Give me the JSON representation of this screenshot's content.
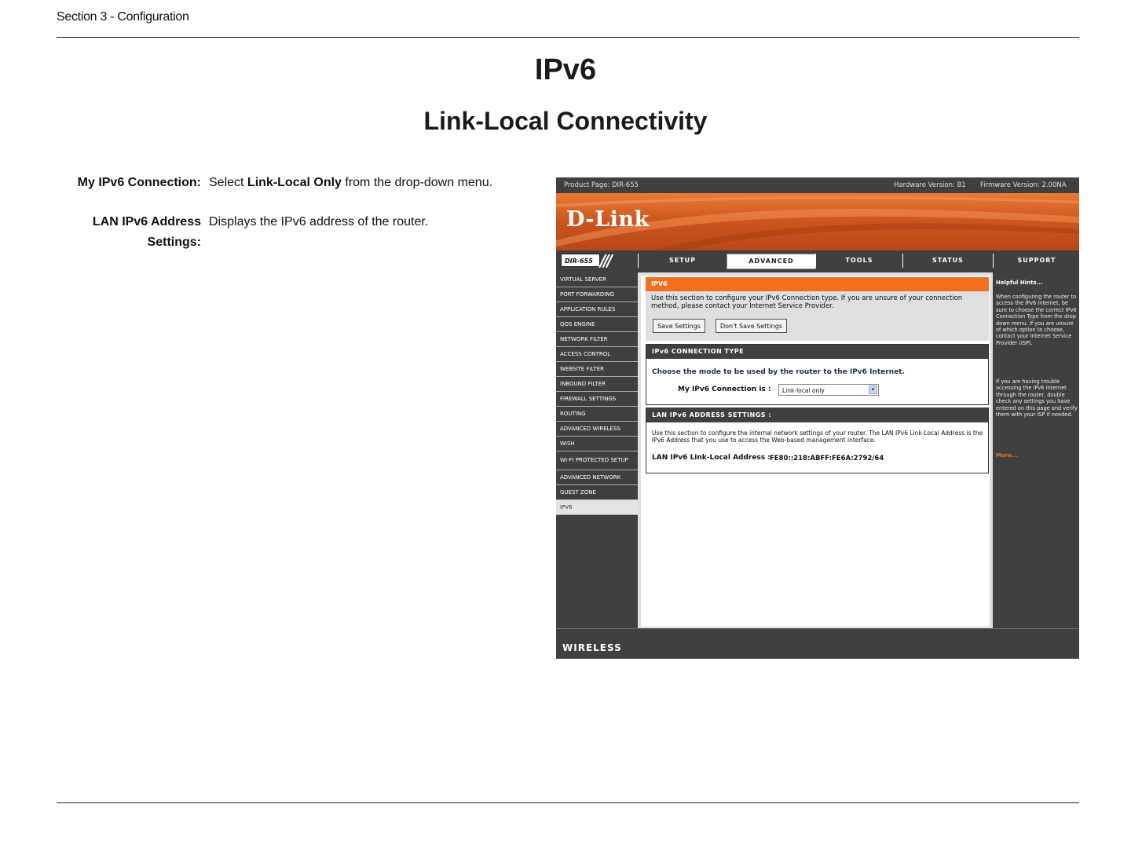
{
  "header": {
    "section": "Section 3 - Configuration"
  },
  "title": "IPv6",
  "subtitle": "Link-Local Connectivity",
  "definitions": [
    {
      "term": "My IPv6 Connection:",
      "desc_pre": "Select ",
      "desc_bold": "Link-Local Only",
      "desc_post": " from the drop-down menu."
    },
    {
      "term": "LAN IPv6 Address Settings:",
      "desc": "Displays the IPv6 address of the router."
    }
  ],
  "router": {
    "top_bar": {
      "product": "Product Page: DIR-655",
      "hardware": "Hardware Version: B1",
      "firmware": "Firmware Version: 2.00NA"
    },
    "logo": "D-Link",
    "model": "DIR-655",
    "tabs": [
      "SETUP",
      "ADVANCED",
      "TOOLS",
      "STATUS",
      "SUPPORT"
    ],
    "active_tab": "ADVANCED",
    "left_nav": [
      "VIRTUAL SERVER",
      "PORT FORWARDING",
      "APPLICATION RULES",
      "QOS ENGINE",
      "NETWORK FILTER",
      "ACCESS CONTROL",
      "WEBSITE FILTER",
      "INBOUND FILTER",
      "FIREWALL SETTINGS",
      "ROUTING",
      "ADVANCED WIRELESS",
      "WISH",
      "WI-FI PROTECTED SETUP",
      "ADVANCED NETWORK",
      "GUEST ZONE",
      "IPV6"
    ],
    "selected_nav": "IPV6",
    "ipv6_box": {
      "title": "IPV6",
      "text": "Use this section to configure your IPv6 Connection type. If you are unsure of your connection method, please contact your Internet Service Provider.",
      "save_label": "Save Settings",
      "dont_save_label": "Don't Save Settings"
    },
    "conn_type": {
      "title": "IPv6 CONNECTION TYPE",
      "choose": "Choose the mode to be used by the router to the IPv6 Internet.",
      "label": "My IPv6 Connection is :",
      "value": "Link-local only"
    },
    "lan_settings": {
      "title": "LAN IPv6 ADDRESS SETTINGS :",
      "desc": "Use this section to configure the internal network settings of your router. The LAN IPv6 Link-Local Address is the IPv6 Address that you use to access the Web-based management interface.",
      "addr_label": "LAN IPv6 Link-Local Address :",
      "addr_value": "FE80::218:ABFF:FE6A:2792/64"
    },
    "hints": {
      "title": "Helpful Hints...",
      "p1": "When configuring the router to access the IPv6 Internet, be sure to choose the correct IPv6 Connection Type from the drop down menu. If you are unsure of which option to choose, contact your Internet Service Provider (ISP).",
      "p2": "If you are having trouble accessing the IPv6 Internet through the router, double check any settings you have entered on this page and verify them with your ISP if needed.",
      "more": "More..."
    },
    "footer": "WIRELESS",
    "colors": {
      "orange": "#f1701d",
      "dark": "#404040"
    }
  }
}
